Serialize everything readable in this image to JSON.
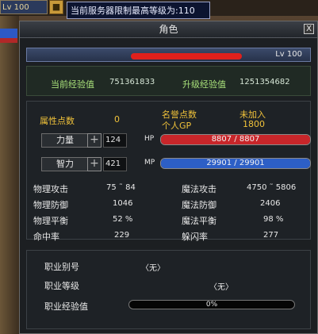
{
  "hud": {
    "level_mini": "Lv 100",
    "tooltip": "当前服务器限制最高等级为:110",
    "chest_icon": "chest-icon"
  },
  "window": {
    "title": "角色",
    "close": "X"
  },
  "character": {
    "level_label": "Lv 100"
  },
  "experience": {
    "current_label": "当前经验值",
    "current_value": "751361833",
    "levelup_label": "升级经验值",
    "levelup_value": "1251354682"
  },
  "stats": {
    "attr_points_label": "属性点数",
    "attr_points_value": "0",
    "fame_label": "名誉点数",
    "personal_gp_label": "个人GP",
    "fame_value": "未加入",
    "personal_gp_value": "1800",
    "strength_label": "力量",
    "strength_value": "124",
    "hp_tag": "HP",
    "hp_text": "8807 / 8807",
    "hp_fraction": 1,
    "intelligence_label": "智力",
    "intelligence_value": "421",
    "mp_tag": "MP",
    "mp_text": "29901 / 29901",
    "mp_fraction": 1,
    "rows": [
      {
        "l1": "物理攻击",
        "v1": "75 ˜ 84",
        "l2": "魔法攻击",
        "v2": "4750 ˜ 5806"
      },
      {
        "l1": "物理防御",
        "v1": "1046",
        "l2": "魔法防御",
        "v2": "2406"
      },
      {
        "l1": "物理平衡",
        "v1": "52 %",
        "l2": "魔法平衡",
        "v2": "98 %"
      },
      {
        "l1": "命中率",
        "v1": "229",
        "l2": "躲闪率",
        "v2": "277"
      }
    ]
  },
  "job": {
    "alias_label": "职业别号",
    "alias_value": "〈无〉",
    "level_label": "职业等级",
    "level_value": "〈无〉",
    "exp_label": "职业经验值",
    "exp_text": "0%",
    "exp_fraction": 0
  },
  "colors": {
    "hp": "#c8262a",
    "mp": "#2d5fc6",
    "accent_yellow": "#f0c23a",
    "exp_green": "#a8e07a"
  }
}
